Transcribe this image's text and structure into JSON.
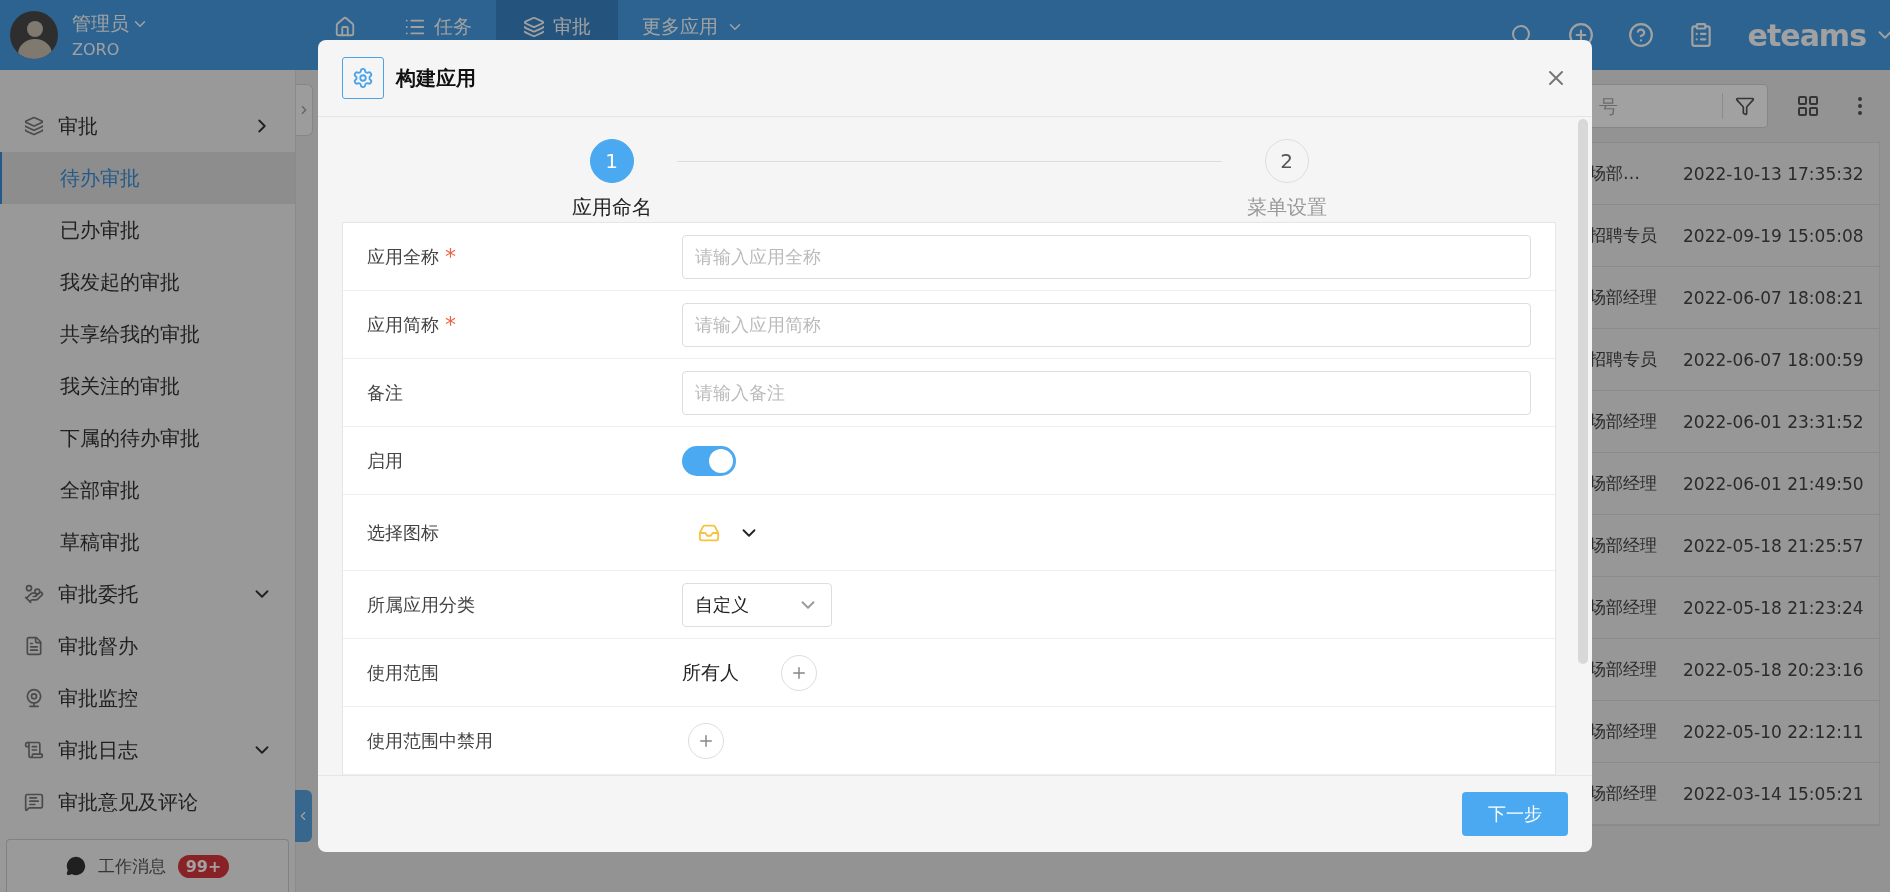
{
  "header": {
    "user": {
      "name": "管理员",
      "account": "ZORO"
    },
    "nav": [
      {
        "kind": "home",
        "selected": false
      },
      {
        "kind": "list",
        "label": "任务",
        "selected": false
      },
      {
        "kind": "layers",
        "label": "审批",
        "selected": true
      },
      {
        "kind": "more",
        "label": "更多应用",
        "selected": false
      }
    ],
    "brand": "eteams"
  },
  "sidebar": {
    "items": [
      {
        "label": "审批",
        "kind": "open_group",
        "children": [
          {
            "label": "待办审批",
            "selected": true
          },
          {
            "label": "已办审批",
            "selected": false
          },
          {
            "label": "我发起的审批",
            "selected": false
          },
          {
            "label": "共享给我的审批",
            "selected": false
          },
          {
            "label": "我关注的审批",
            "selected": false
          },
          {
            "label": "下属的待办审批",
            "selected": false
          },
          {
            "label": "全部审批",
            "selected": false
          },
          {
            "label": "草稿审批",
            "selected": false
          }
        ]
      },
      {
        "label": "审批委托",
        "kind": "group"
      },
      {
        "label": "审批督办",
        "kind": "link"
      },
      {
        "label": "审批监控",
        "kind": "link"
      },
      {
        "label": "审批日志",
        "kind": "group"
      },
      {
        "label": "审批意见及评论",
        "kind": "link"
      }
    ],
    "messages": {
      "label": "工作消息",
      "badge": "99+"
    }
  },
  "table": {
    "search_placeholder": "号",
    "rows": [
      {
        "column_1": "场部…",
        "column_2": "2022-10-13 17:35:32"
      },
      {
        "column_1": "招聘专员",
        "column_2": "2022-09-19 15:05:08"
      },
      {
        "column_1": "场部经理",
        "column_2": "2022-06-07 18:08:21"
      },
      {
        "column_1": "招聘专员",
        "column_2": "2022-06-07 18:00:59"
      },
      {
        "column_1": "场部经理",
        "column_2": "2022-06-01 23:31:52"
      },
      {
        "column_1": "场部经理",
        "column_2": "2022-06-01 21:49:50"
      },
      {
        "column_1": "场部经理",
        "column_2": "2022-05-18 21:25:57"
      },
      {
        "column_1": "场部经理",
        "column_2": "2022-05-18 21:23:24"
      },
      {
        "column_1": "场部经理",
        "column_2": "2022-05-18 20:23:16"
      },
      {
        "column_1": "场部经理",
        "column_2": "2022-05-10 22:12:11"
      },
      {
        "column_1": "场部经理",
        "column_2": "2022-03-14 15:05:21"
      }
    ]
  },
  "modal": {
    "title": "构建应用",
    "steps": [
      {
        "number": "1",
        "label": "应用命名",
        "selected": true
      },
      {
        "number": "2",
        "label": "菜单设置",
        "selected": false
      }
    ],
    "fields": [
      {
        "kind": "input",
        "label": "应用全称",
        "required_mark": "*",
        "placeholder": "请输入应用全称"
      },
      {
        "kind": "input",
        "label": "应用简称",
        "required_mark": "*",
        "placeholder": "请输入应用简称"
      },
      {
        "kind": "input",
        "label": "备注",
        "placeholder": "请输入备注"
      },
      {
        "kind": "switch",
        "label": "启用",
        "on": true
      },
      {
        "kind": "icon_picker",
        "label": "选择图标"
      },
      {
        "kind": "select",
        "label": "所属应用分类",
        "value": "自定义"
      },
      {
        "kind": "scope",
        "label": "使用范围",
        "value": "所有人"
      },
      {
        "kind": "scope",
        "label": "使用范围中禁用"
      }
    ],
    "next_button": "下一步"
  }
}
